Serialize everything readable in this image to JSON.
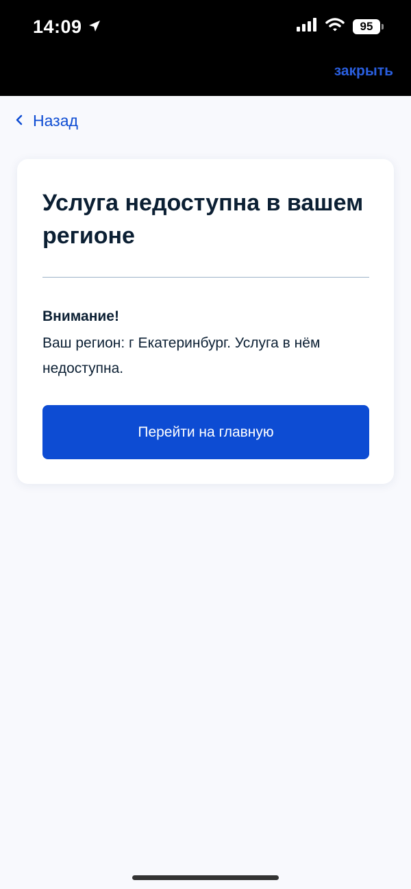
{
  "status_bar": {
    "time": "14:09",
    "battery": "95",
    "location_icon": "location-arrow-icon",
    "signal_icon": "cellular-signal-icon",
    "wifi_icon": "wifi-icon"
  },
  "header": {
    "close_label": "закрыть"
  },
  "nav": {
    "back_label": "Назад",
    "back_icon": "chevron-left-icon"
  },
  "card": {
    "title": "Услуга недоступна в вашем регионе",
    "notice_label": "Внимание!",
    "notice_text": "Ваш регион: г Екатеринбург. Услуга в нём недоступна.",
    "button_label": "Перейти на главную"
  },
  "colors": {
    "accent": "#0d4cd3",
    "text": "#0b1f33",
    "background": "#f8f9fd"
  }
}
